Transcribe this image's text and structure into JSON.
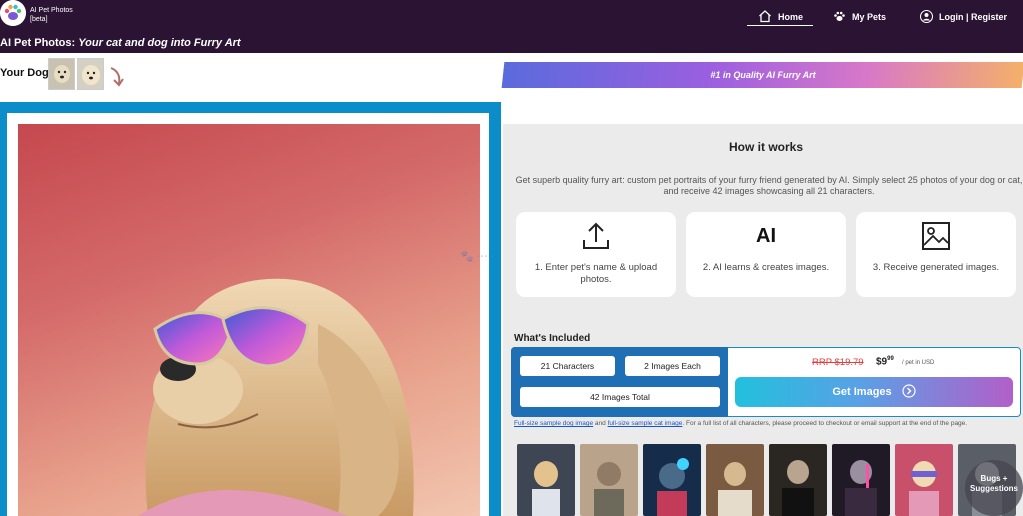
{
  "header": {
    "app_name": "AI Pet Photos",
    "app_tag": "[beta]",
    "tagline_prefix": "AI Pet Photos:",
    "tagline_emphasis": "Your cat and dog into Furry Art"
  },
  "nav": {
    "home": "Home",
    "my_pets": "My Pets",
    "login": "Login | Register"
  },
  "sample": {
    "your_dog_label": "Your Dog"
  },
  "banner": {
    "text": "#1 in Quality AI Furry Art"
  },
  "how_it_works": {
    "title": "How it works",
    "description": "Get superb quality furry art: custom pet portraits of your furry friend generated by AI. Simply select 25 photos of your dog or cat, and receive 42 images showcasing all 21 characters.",
    "steps": [
      {
        "icon": "upload-icon",
        "label": "1. Enter pet's name & upload photos."
      },
      {
        "icon": "ai-icon",
        "label": "2. AI learns & creates images.",
        "icon_text": "AI"
      },
      {
        "icon": "image-icon",
        "label": "3. Receive generated images."
      }
    ]
  },
  "included": {
    "title": "What's Included",
    "chips": [
      "21 Characters",
      "2 Images Each",
      "42 Images Total"
    ],
    "rrp": "RRP $19.79",
    "price_main": "$9",
    "price_cents": "99",
    "price_unit": "/ pet in USD",
    "cta": "Get Images",
    "note_link1": "Full-size sample dog image",
    "note_and": " and ",
    "note_link2": "full-size sample cat image",
    "note_rest": ". For a full list of all characters, please proceed to checkout or email support at the end of the page."
  },
  "bugs_button": "Bugs + Suggestions",
  "colors": {
    "topbar": "#2a1333",
    "frame": "#0a8dc9",
    "panel": "#ebebec",
    "offer_blue": "#1f6fb4",
    "rrp_red": "#e04040"
  }
}
